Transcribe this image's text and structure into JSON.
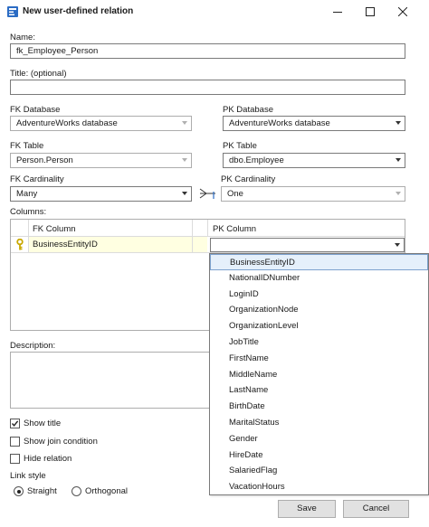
{
  "window": {
    "title": "New user-defined relation",
    "controls": [
      "minimize-icon",
      "maximize-icon",
      "close-icon"
    ]
  },
  "form": {
    "name_label": "Name:",
    "name_value": "fk_Employee_Person",
    "title_label": "Title: (optional)",
    "title_value": "",
    "fk_database_label": "FK Database",
    "fk_database_value": "AdventureWorks database",
    "pk_database_label": "PK Database",
    "pk_database_value": "AdventureWorks database",
    "fk_table_label": "FK Table",
    "fk_table_value": "Person.Person",
    "pk_table_label": "PK Table",
    "pk_table_value": "dbo.Employee",
    "fk_cardinality_label": "FK Cardinality",
    "fk_cardinality_value": "Many",
    "pk_cardinality_label": "PK Cardinality",
    "pk_cardinality_value": "One",
    "columns_label": "Columns:",
    "description_label": "Description:",
    "description_value": ""
  },
  "columns_grid": {
    "headers": [
      "FK Column",
      "PK Column"
    ],
    "rows": [
      {
        "fk": "BusinessEntityID",
        "pk": "",
        "key_icon": "key-icon"
      }
    ]
  },
  "pk_dropdown": {
    "selected_index": 0,
    "options": [
      "BusinessEntityID",
      "NationalIDNumber",
      "LoginID",
      "OrganizationNode",
      "OrganizationLevel",
      "JobTitle",
      "FirstName",
      "MiddleName",
      "LastName",
      "BirthDate",
      "MaritalStatus",
      "Gender",
      "HireDate",
      "SalariedFlag",
      "VacationHours"
    ]
  },
  "options": {
    "show_title": {
      "label": "Show title",
      "checked": true
    },
    "show_join_condition": {
      "label": "Show join condition",
      "checked": false
    },
    "hide_relation": {
      "label": "Hide relation",
      "checked": false
    },
    "link_style_label": "Link style",
    "link_style": [
      {
        "label": "Straight",
        "selected": true
      },
      {
        "label": "Orthogonal",
        "selected": false
      }
    ]
  },
  "buttons": {
    "save": "Save",
    "cancel": "Cancel"
  },
  "colors": {
    "key": "#c9a800",
    "row_highlight": "#ffffe1",
    "selection": "#e5f0fb",
    "selection_border": "#7da2ce"
  }
}
